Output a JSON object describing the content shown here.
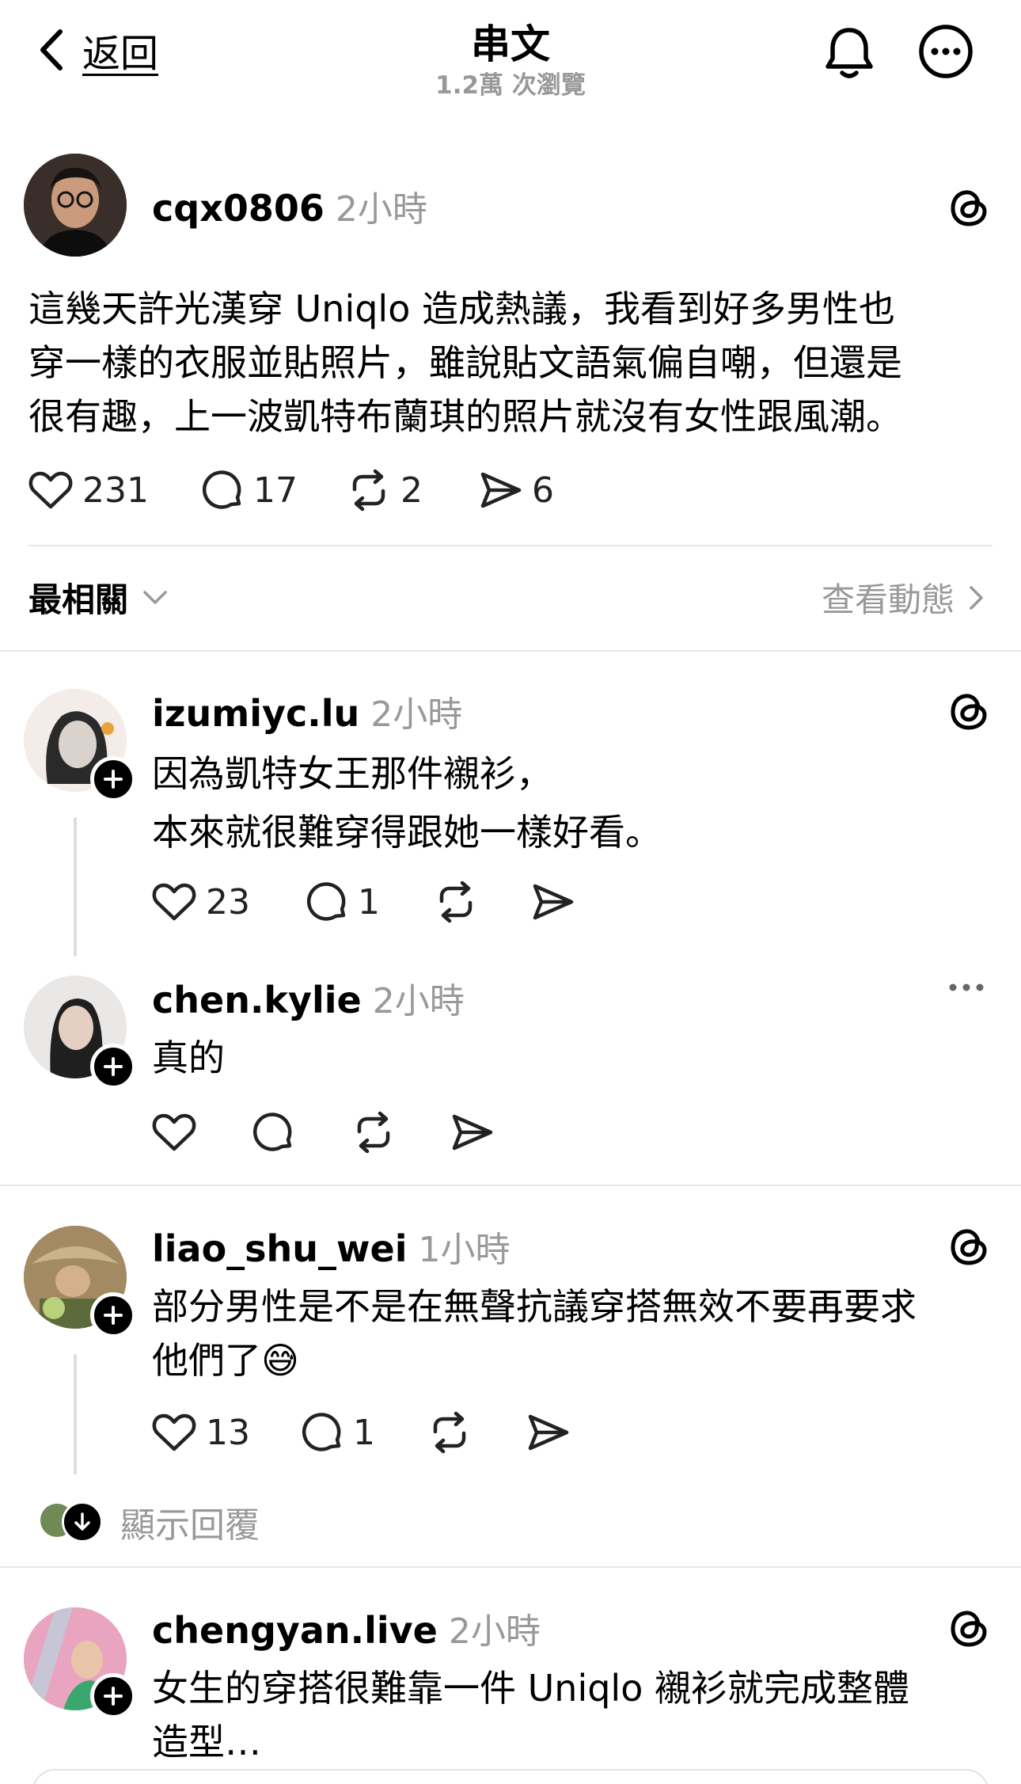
{
  "header": {
    "back_label": "返回",
    "title": "串文",
    "views": "1.2萬 次瀏覽"
  },
  "main_post": {
    "username": "cqx0806",
    "time": "2小時",
    "lines": [
      "這幾天許光漢穿 Uniqlo 造成熱議，我看到好多男性也",
      "穿一樣的衣服並貼照片，雖說貼文語氣偏自嘲，但還是",
      "很有趣，上一波凱特布蘭琪的照片就沒有女性跟風潮。"
    ],
    "likes": "231",
    "comments": "17",
    "reposts": "2",
    "shares": "6"
  },
  "sort": {
    "label": "最相關",
    "activity_link": "查看動態"
  },
  "replies": [
    {
      "username": "izumiyc.lu",
      "time": "2小時",
      "lines": [
        "因為凱特女王那件襯衫，",
        "本來就很難穿得跟她一樣好看。"
      ],
      "likes": "23",
      "comments": "1"
    },
    {
      "username": "chen.kylie",
      "time": "2小時",
      "lines": [
        "真的"
      ]
    },
    {
      "username": "liao_shu_wei",
      "time": "1小時",
      "lines": [
        "部分男性是不是在無聲抗議穿搭無效不要再要求",
        "他們了😅"
      ],
      "likes": "13",
      "comments": "1",
      "show_replies": "顯示回覆"
    },
    {
      "username": "chengyan.live",
      "time": "2小時",
      "lines": [
        "女生的穿搭很難靠一件 Uniqlo 襯衫就完成整體",
        "造型…"
      ]
    }
  ],
  "icons": {
    "back": "chevron-left-icon",
    "bell": "bell-icon",
    "more": "more-circle-icon",
    "threads": "threads-logo-icon",
    "like": "heart-icon",
    "comment": "comment-bubble-icon",
    "repost": "repost-icon",
    "share": "send-icon",
    "follow": "plus-icon"
  },
  "colors": {
    "text": "#000000",
    "secondary": "#999999",
    "divider": "#e6e6e6"
  }
}
